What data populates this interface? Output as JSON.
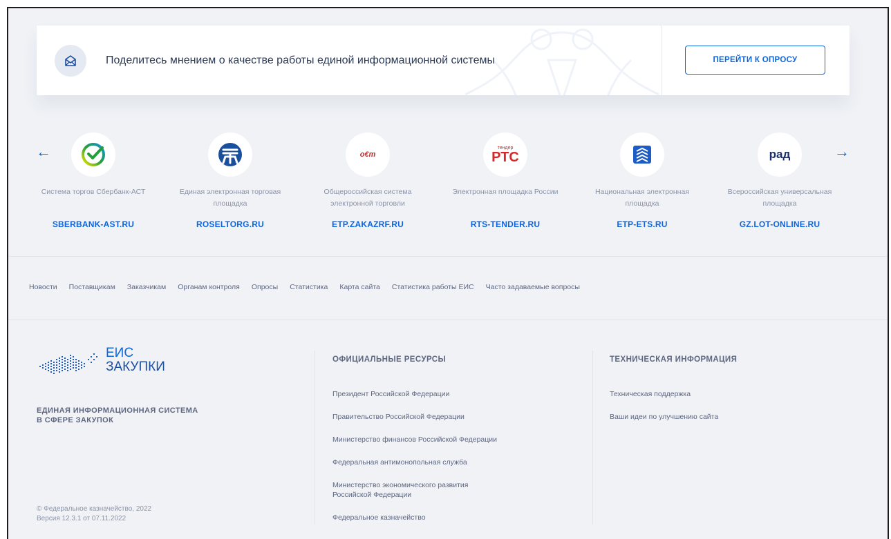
{
  "banner": {
    "text": "Поделитесь мнением о качестве работы единой информационной системы",
    "button_label": "ПЕРЕЙТИ К ОПРОСУ",
    "icon": "envelope-icon"
  },
  "carousel": {
    "prev_arrow": "←",
    "next_arrow": "→",
    "platforms": [
      {
        "desc": "Система торгов Сбербанк-АСТ",
        "link": "SBERBANK-AST.RU",
        "logo": "sberbank-logo"
      },
      {
        "desc": "Единая электронная торговая площадка",
        "link": "ROSELTORG.RU",
        "logo": "roseltorg-logo"
      },
      {
        "desc": "Общероссийская система электронной торговли",
        "link": "ETP.ZAKAZRF.RU",
        "logo": "zakazrf-logo",
        "logo_text": "о€т"
      },
      {
        "desc": "Электронная площадка России",
        "link": "RTS-TENDER.RU",
        "logo": "rts-logo",
        "logo_small": "тендер",
        "logo_text": "РТС"
      },
      {
        "desc": "Национальная электронная площадка",
        "link": "ETP-ETS.RU",
        "logo": "ets-logo"
      },
      {
        "desc": "Всероссийская универсальная площадка",
        "link": "GZ.LOT-ONLINE.RU",
        "logo": "rad-logo",
        "logo_text": "рад"
      }
    ]
  },
  "nav": [
    "Новости",
    "Поставщикам",
    "Заказчикам",
    "Органам контроля",
    "Опросы",
    "Статистика",
    "Карта сайта",
    "Статистика работы ЕИС",
    "Часто задаваемые вопросы"
  ],
  "footer": {
    "brand_top": "ЕИС",
    "brand_bottom": "ЗАКУПКИ",
    "brand_full_line1": "ЕДИНАЯ ИНФОРМАЦИОННАЯ СИСТЕМА",
    "brand_full_line2": "В СФЕРЕ ЗАКУПОК",
    "copyright": "© Федеральное казначейство, 2022",
    "version": "Версия 12.3.1 от 07.11.2022",
    "official_title": "ОФИЦИАЛЬНЫЕ РЕСУРСЫ",
    "official_links": [
      "Президент Российской Федерации",
      "Правительство Российской Федерации",
      "Министерство финансов Российской Федерации",
      "Федеральная антимонопольная служба",
      "Министерство экономического развития Российской Федерации",
      "Федеральное казначейство"
    ],
    "tech_title": "ТЕХНИЧЕСКАЯ ИНФОРМАЦИЯ",
    "tech_links": [
      "Техническая поддержка",
      "Ваши идеи по улучшению сайта"
    ]
  },
  "colors": {
    "accent": "#0d65df",
    "background": "#f0f2f6",
    "text": "#5d6780"
  }
}
